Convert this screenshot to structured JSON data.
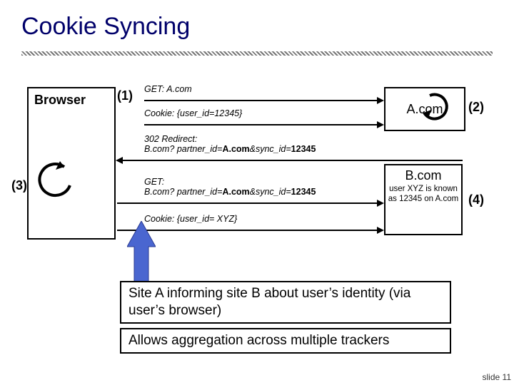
{
  "title": "Cookie Syncing",
  "browser_label": "Browser",
  "step_labels": {
    "s1": "(1)",
    "s2": "(2)",
    "s3": "(3)",
    "s4": "(4)"
  },
  "msgs": {
    "get_a_prefix": "GET:",
    "get_a_host": " A.com",
    "cookie_a_prefix": "Cookie:",
    "cookie_a_val": " {user_id=12345}",
    "redir_line1_prefix": "302 Redirect:",
    "redir_line2_a": "B.com? partner_id=",
    "redir_line2_b": "A.com",
    "redir_line2_c": "&sync_id=",
    "redir_line2_d": "12345",
    "get_b_prefix": "GET:",
    "get_b_line2_a": "B.com? partner_id=",
    "get_b_line2_b": "A.com",
    "get_b_line2_c": "&sync_id=",
    "get_b_line2_d": "12345",
    "cookie_b_prefix": "Cookie:",
    "cookie_b_val": " {user_id= XYZ}"
  },
  "acom_label": "A.com",
  "bcom_label": "B.com",
  "bcom_note": "user XYZ is known as 12345 on A.com",
  "callout1": "Site A informing site B about user’s identity (via user’s browser)",
  "callout2": "Allows aggregation across multiple trackers",
  "footer": "slide 11"
}
